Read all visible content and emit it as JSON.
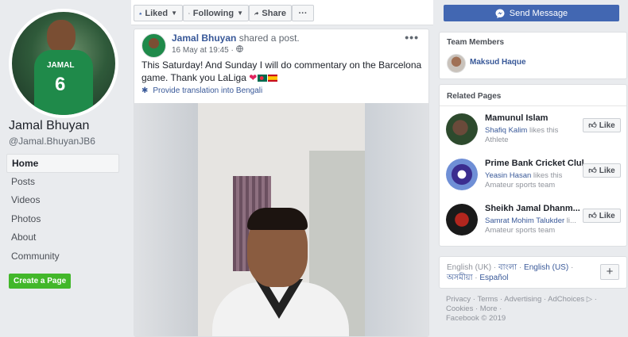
{
  "left": {
    "page_name": "Jamal Bhuyan",
    "page_handle": "@Jamal.BhuyanJB6",
    "avatar_jersey_name": "JAMAL",
    "avatar_jersey_number": "6",
    "nav": [
      "Home",
      "Posts",
      "Videos",
      "Photos",
      "About",
      "Community"
    ],
    "create_page_label": "Create a Page"
  },
  "actionbar": {
    "liked": "Liked",
    "following": "Following",
    "share": "Share",
    "more": "···"
  },
  "post": {
    "author": "Jamal Bhuyan",
    "action": "shared a post.",
    "date": "16 May at 19:45 ·",
    "text": "This Saturday! And Sunday I will do commentary on the Barcelona game. Thank you LaLiga",
    "translate_label": "Provide translation into Bengali",
    "menu": "•••"
  },
  "right": {
    "send_message": "Send Message",
    "team_title": "Team Members",
    "team_member": "Maksud Haque",
    "related_title": "Related Pages",
    "related": [
      {
        "name": "Mamunul Islam",
        "friend": "Shafiq Kalim",
        "suffix": "likes this",
        "category": "Athlete"
      },
      {
        "name": "Prime Bank Cricket Club",
        "friend": "Yeasin Hasan",
        "suffix": "likes this",
        "category": "Amateur sports team"
      },
      {
        "name": "Sheikh Jamal Dhanm...",
        "friend": "Samrat Mohim Talukder",
        "suffix": "li...",
        "category": "Amateur sports team"
      }
    ],
    "like_label": "Like",
    "languages": {
      "current": "English (UK)",
      "others": [
        "বাংলা",
        "English (US)",
        "অসমীয়া",
        "Español"
      ]
    },
    "footer": {
      "line1": [
        "Privacy",
        "Terms",
        "Advertising",
        "AdChoices",
        "Cookies",
        "More"
      ],
      "copyright": "Facebook © 2019"
    }
  },
  "colors": {
    "brand_blue": "#4267b2",
    "link_blue": "#385898",
    "green_button": "#42b72a",
    "background": "#e9ebee"
  }
}
